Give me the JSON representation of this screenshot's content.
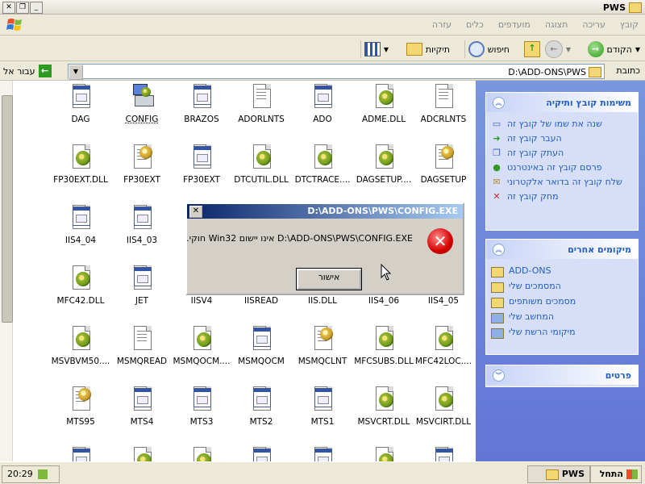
{
  "window": {
    "title": "PWS"
  },
  "menu": [
    "קובץ",
    "עריכה",
    "תצוגה",
    "מועדפים",
    "כלים",
    "עזרה"
  ],
  "toolbar": {
    "back": "הקודם",
    "search": "חיפוש",
    "folders": "תיקיות"
  },
  "address": {
    "label": "כתובת",
    "path": "D:\\ADD-ONS\\PWS",
    "go": "עבור אל"
  },
  "files": [
    {
      "name": "DAG",
      "icon": "win"
    },
    {
      "name": "CONFIG",
      "icon": "config"
    },
    {
      "name": "BRAZOS",
      "icon": "win"
    },
    {
      "name": "ADORLNTS",
      "icon": "txt"
    },
    {
      "name": "ADO",
      "icon": "win"
    },
    {
      "name": "ADME.DLL",
      "icon": "dll"
    },
    {
      "name": "ADCRLNTS",
      "icon": "txt"
    },
    {
      "name": "FP30EXT.DLL",
      "icon": "dll"
    },
    {
      "name": "FP30EXT",
      "icon": "inf"
    },
    {
      "name": "FP30EXT",
      "icon": "win"
    },
    {
      "name": "DTCUTIL.DLL",
      "icon": "dll"
    },
    {
      "name": "DTCTRACE....",
      "icon": "dll"
    },
    {
      "name": "DAGSETUP....",
      "icon": "dll"
    },
    {
      "name": "DAGSETUP",
      "icon": "inf"
    },
    {
      "name": "IIS4_04",
      "icon": "win"
    },
    {
      "name": "IIS4_03",
      "icon": "win"
    },
    {
      "name": "",
      "icon": "none"
    },
    {
      "name": "",
      "icon": "none"
    },
    {
      "name": "",
      "icon": "none"
    },
    {
      "name": "",
      "icon": "none"
    },
    {
      "name": "",
      "icon": "none"
    },
    {
      "name": "MFC42.DLL",
      "icon": "dll"
    },
    {
      "name": "JET",
      "icon": "win"
    },
    {
      "name": "IISV4",
      "icon": "none"
    },
    {
      "name": "IISREAD",
      "icon": "none"
    },
    {
      "name": "IIS.DLL",
      "icon": "none"
    },
    {
      "name": "IIS4_06",
      "icon": "none"
    },
    {
      "name": "IIS4_05",
      "icon": "none"
    },
    {
      "name": "MSVBVM50....",
      "icon": "dll"
    },
    {
      "name": "MSMQREAD",
      "icon": "txt"
    },
    {
      "name": "MSMQOCM....",
      "icon": "dll"
    },
    {
      "name": "MSMQOCM",
      "icon": "win"
    },
    {
      "name": "MSMQCLNT",
      "icon": "inf"
    },
    {
      "name": "MFCSUBS.DLL",
      "icon": "dll"
    },
    {
      "name": "MFC42LOC....",
      "icon": "dll"
    },
    {
      "name": "MTS95",
      "icon": "inf"
    },
    {
      "name": "MTS4",
      "icon": "win"
    },
    {
      "name": "MTS3",
      "icon": "win"
    },
    {
      "name": "MTS2",
      "icon": "win"
    },
    {
      "name": "MTS1",
      "icon": "win"
    },
    {
      "name": "MSVCRT.DLL",
      "icon": "dll"
    },
    {
      "name": "MSVCIRT.DLL",
      "icon": "dll"
    },
    {
      "name": "",
      "icon": "win"
    },
    {
      "name": "",
      "icon": "dll"
    },
    {
      "name": "",
      "icon": "dll"
    },
    {
      "name": "",
      "icon": "win"
    },
    {
      "name": "",
      "icon": "win"
    },
    {
      "name": "",
      "icon": "dll"
    },
    {
      "name": "",
      "icon": "win"
    }
  ],
  "tasks": {
    "title": "משימות קובץ ותיקיה",
    "items": [
      "שנה את שמו של קובץ זה",
      "העבר קובץ זה",
      "העתק קובץ זה",
      "פרסם קובץ זה באינטרנט",
      "שלח קובץ זה בדואר אלקטרוני",
      "מחק קובץ זה"
    ]
  },
  "places": {
    "title": "מיקומים אחרים",
    "items": [
      "ADD-ONS",
      "המסמכים שלי",
      "מסמכים משותפים",
      "המחשב שלי",
      "מיקומי הרשת שלי"
    ]
  },
  "details": {
    "title": "פרטים"
  },
  "dialog": {
    "title": "D:\\ADD-ONS\\PWS\\CONFIG.EXE",
    "message": "D:\\ADD-ONS\\PWS\\CONFIG.EXE אינו יישום Win32 חוקי.",
    "ok": "אישור"
  },
  "taskbar": {
    "start": "התחל",
    "window": "PWS",
    "clock": "20:29"
  }
}
